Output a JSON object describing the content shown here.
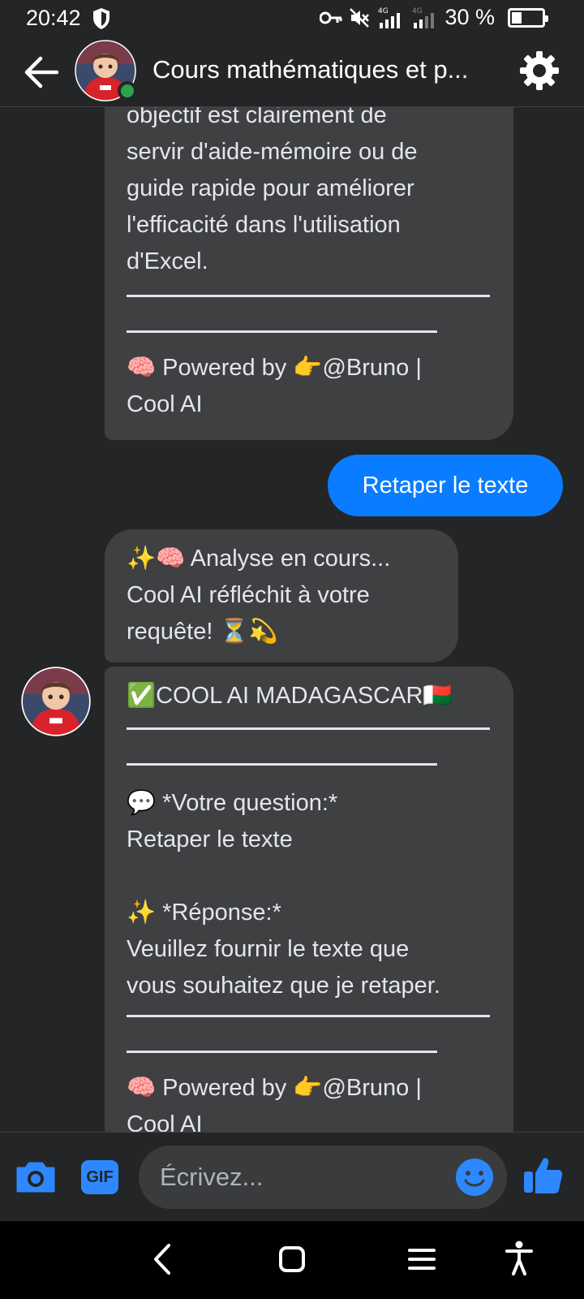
{
  "status_bar": {
    "time": "20:42",
    "network": "4G",
    "battery": "30 %"
  },
  "header": {
    "title": "Cours mathématiques et p..."
  },
  "messages": {
    "first": {
      "lines": [
        "objectif est clairement de",
        "servir d'aide-mémoire ou de",
        "guide rapide pour améliorer",
        "l'efficacité dans l'utilisation",
        "d'Excel."
      ],
      "footer_line1": "🧠 Powered by 👉@Bruno |",
      "footer_line2": "Cool AI"
    },
    "outgoing": {
      "text": "Retaper le texte"
    },
    "analysis": {
      "line1": "✨🧠 Analyse en cours...",
      "line2": "Cool AI réfléchit à votre",
      "line3": "requête! ⏳💫"
    },
    "reply": {
      "heading": "✅COOL AI MADAGASCAR🇲🇬",
      "question_label": "💬 *Votre question:*",
      "question_text": "Retaper le texte",
      "answer_label": "✨ *Réponse:*",
      "answer_line1": "Veuillez fournir le texte que",
      "answer_line2": "vous souhaitez que je retaper.",
      "footer_line1": "🧠 Powered by 👉@Bruno |",
      "footer_line2": "Cool AI"
    }
  },
  "composer": {
    "placeholder": "Écrivez...",
    "gif_label": "GIF"
  },
  "colors": {
    "background": "#242526",
    "bubble": "#3e4042",
    "accent": "#0a7cff",
    "online": "#31a24c"
  },
  "icons": [
    "shield-icon",
    "key-icon",
    "mute-icon",
    "signal-icon",
    "battery-icon",
    "back-arrow-icon",
    "gear-icon",
    "camera-icon",
    "gif-icon",
    "emoji-icon",
    "thumbs-up-icon",
    "nav-back-icon",
    "nav-home-icon",
    "nav-recents-icon",
    "accessibility-icon"
  ]
}
